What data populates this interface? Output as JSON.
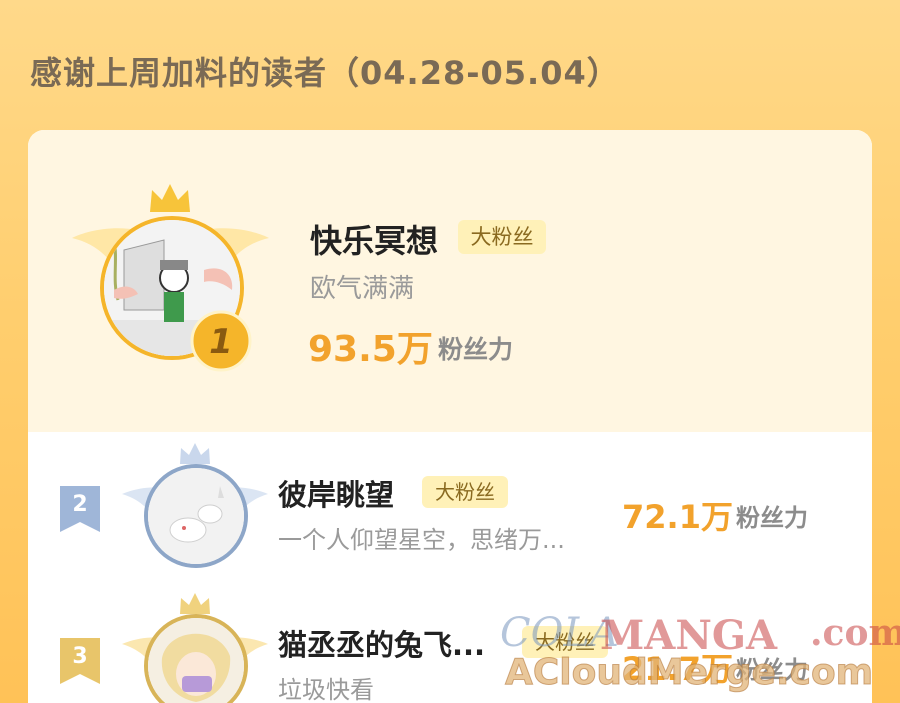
{
  "header": {
    "title": "感谢上周加料的读者（04.28-05.04）"
  },
  "readers": [
    {
      "rank": "1",
      "name": "快乐冥想",
      "badge": "大粉丝",
      "subtitle": "欧气满满",
      "score": "93.5万",
      "score_label": "粉丝力"
    },
    {
      "rank": "2",
      "name": "彼岸眺望",
      "badge": "大粉丝",
      "subtitle": "一个人仰望星空，思绪万...",
      "score": "72.1万",
      "score_label": "粉丝力"
    },
    {
      "rank": "3",
      "name": "猫丞丞的兔飞...",
      "badge": "大粉丝",
      "subtitle": "垃圾快看",
      "score": "21.7万",
      "score_label": "粉丝力"
    }
  ],
  "watermark": {
    "part1": "COLA",
    "part2": "MANGA",
    "part3": ".com",
    "part4": "ACloudMerge.com"
  },
  "colors": {
    "accent": "#f2a22c",
    "gold": "#f5b52a",
    "silver": "#9fb6d8",
    "bronze": "#e8c56a"
  }
}
